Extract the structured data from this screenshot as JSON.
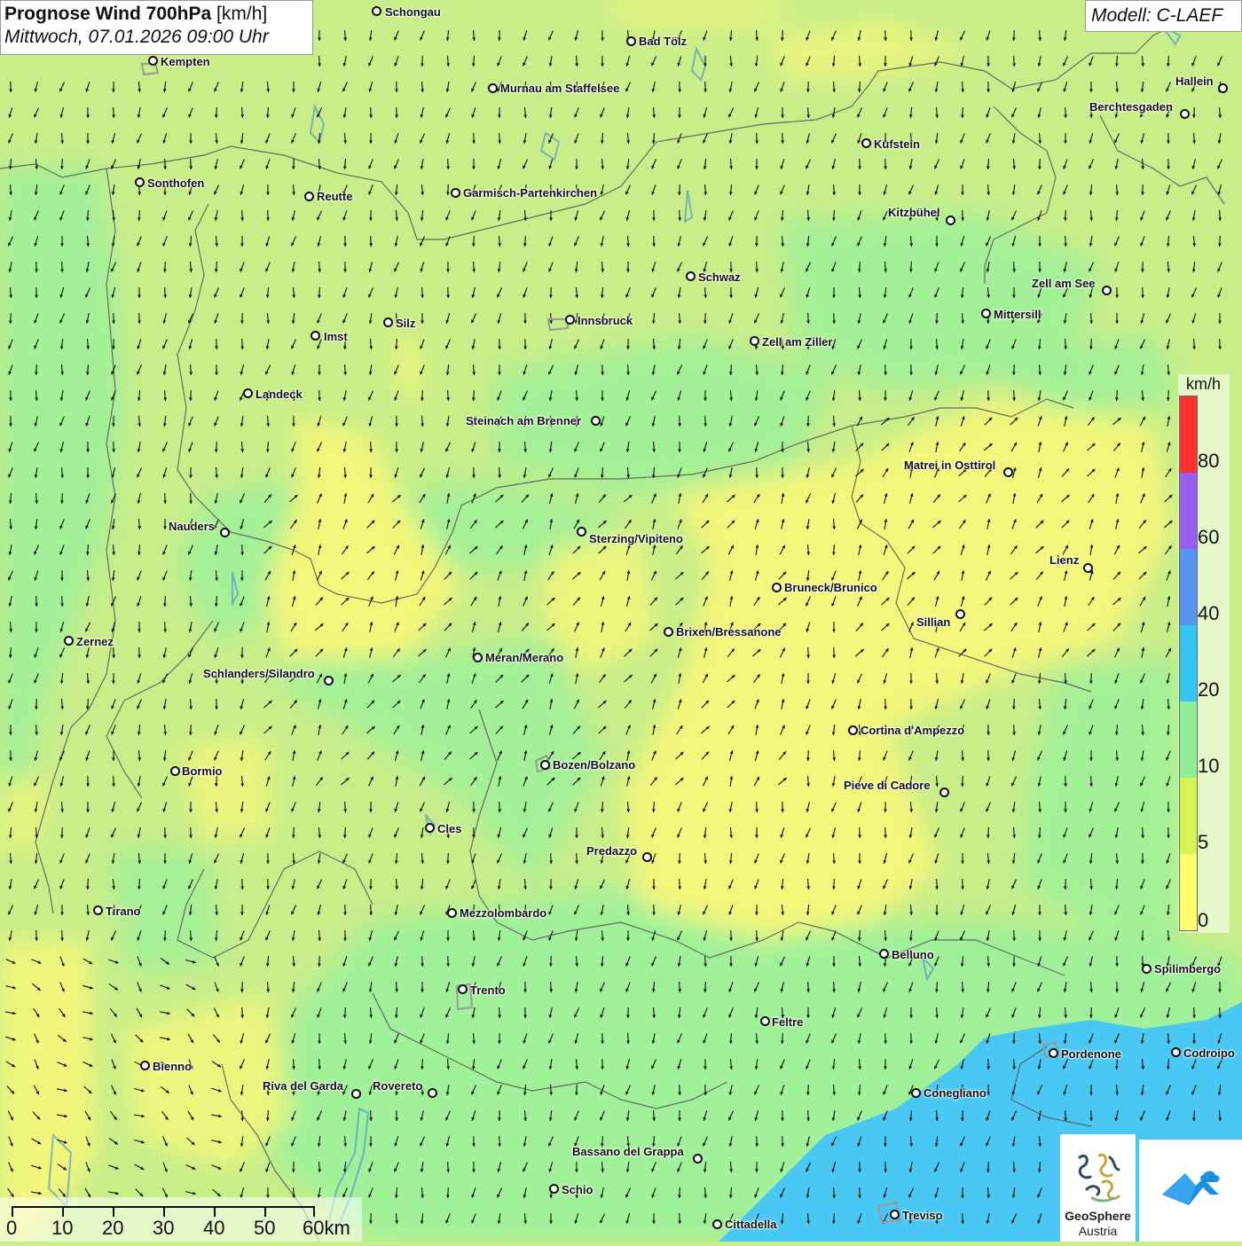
{
  "title": {
    "product_bold": "Prognose Wind 700hPa",
    "unit": "[km/h]",
    "datetime": "Mittwoch, 07.01.2026 09:00 Uhr"
  },
  "model": "Modell: C-LAEF",
  "legend": {
    "unit": "km/h",
    "labels": [
      "80",
      "60",
      "40",
      "20",
      "10",
      "5",
      "0"
    ],
    "colors": {
      "0": "#ffff6e",
      "5": "#d4f552",
      "10": "#90ee98",
      "20": "#36c4f0",
      "40": "#5a94f0",
      "60": "#9b5ff0",
      "80": "#ff3030"
    }
  },
  "cities": [
    "Schongau",
    "Bad Tölz",
    "Kempten",
    "Murnau am Staffelsee",
    "Hallein",
    "Berchtesgaden",
    "Kufstein",
    "Sonthofen",
    "Reutte",
    "Garmisch-Partenkirchen",
    "Kitzbühel",
    "Schwaz",
    "Zell am See",
    "Mittersill",
    "Innsbruck",
    "Silz",
    "Imst",
    "Zell am Ziller",
    "Landeck",
    "Steinach am Brenner",
    "Matrei in Osttirol",
    "Nauders",
    "Sterzing/Vipiteno",
    "Lienz",
    "Bruneck/Brunico",
    "Sillian",
    "Zernez",
    "Brixen/Bressanone",
    "Meran/Merano",
    "Schlanders/Silandro",
    "Cortina d'Ampezzo",
    "Bozen/Bolzano",
    "Bormio",
    "Pieve di Cadore",
    "Cles",
    "Predazzo",
    "Tirano",
    "Mezzolombardo",
    "Belluno",
    "Spilimbergo",
    "Trento",
    "Feltre",
    "Pordenone",
    "Codroipo",
    "Bienno",
    "Riva del Garda",
    "Rovereto",
    "Conegliano",
    "Bassano del Grappa",
    "Schio",
    "Treviso",
    "Cittadella"
  ],
  "scale": {
    "labels": [
      "0",
      "10",
      "20",
      "30",
      "40",
      "50",
      "60km"
    ]
  },
  "logos": {
    "geosphere_line1": "GeoSphere",
    "geosphere_line2": "Austria"
  }
}
